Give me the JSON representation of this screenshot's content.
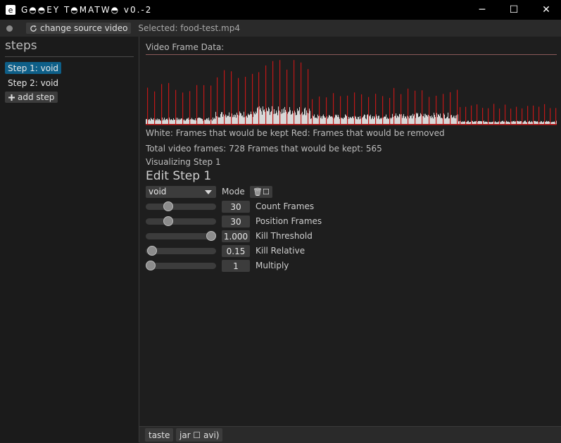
{
  "window": {
    "app_icon_glyph": "e",
    "title": "G◓◓EY T◓MATW◓ v0.-2",
    "controls": {
      "minimize": "─",
      "maximize": "☐",
      "close": "✕"
    }
  },
  "toolbar": {
    "change_source_label": "change source video",
    "change_source_icon": "refresh-icon",
    "selected_text": "Selected: food-test.mp4"
  },
  "steps_panel": {
    "title": "steps",
    "items": [
      {
        "label": "Step 1: void",
        "active": true
      },
      {
        "label": "Step 2: void",
        "active": false
      }
    ],
    "add_step_label": "add step",
    "add_step_icon": "plus-icon"
  },
  "main": {
    "chart_title": "Video Frame Data:",
    "legend_text": "White: Frames that would be kept   Red: Frames that would be removed",
    "stats_text": "Total video frames: 728   Frames that would be kept: 565",
    "visualizing_text": "Visualizing Step 1",
    "edit_title": "Edit Step 1",
    "mode_select_value": "void",
    "mode_label": "Mode",
    "mode_button_label": "🗑☐",
    "sliders": [
      {
        "value": 30,
        "display": "30",
        "label": "Count Frames",
        "fraction": 0.32
      },
      {
        "value": 30,
        "display": "30",
        "label": "Position Frames",
        "fraction": 0.32
      },
      {
        "value": 1.0,
        "display": "1.000",
        "label": "Kill Threshold",
        "fraction": 0.93
      },
      {
        "value": 0.15,
        "display": "0.15",
        "label": "Kill Relative",
        "fraction": 0.09
      },
      {
        "value": 1,
        "display": "1",
        "label": "Multiply",
        "fraction": 0.07
      }
    ]
  },
  "bottom_bar": {
    "taste_label": "taste",
    "jar_label": "jar ☐ avi)"
  },
  "colors": {
    "accent": "#0e5f88",
    "kept_frames": "#d8d8d8",
    "removed_frames": "#c01818"
  },
  "chart_data": {
    "type": "bar",
    "total_frames": 728,
    "kept_frames": 565,
    "series": [
      {
        "name": "White: Frames that would be kept",
        "color": "#d8d8d8"
      },
      {
        "name": "Red: Frames that would be removed",
        "color": "#c01818"
      }
    ],
    "segments": [
      {
        "x0": 0,
        "x1": 0.17,
        "kept_level": 0.08,
        "spike_level": 0.52
      },
      {
        "x0": 0.17,
        "x1": 0.27,
        "kept_level": 0.16,
        "spike_level": 0.67
      },
      {
        "x0": 0.27,
        "x1": 0.4,
        "kept_level": 0.22,
        "spike_level": 0.8
      },
      {
        "x0": 0.4,
        "x1": 0.6,
        "kept_level": 0.12,
        "spike_level": 0.4
      },
      {
        "x0": 0.6,
        "x1": 0.76,
        "kept_level": 0.14,
        "spike_level": 0.45
      },
      {
        "x0": 0.76,
        "x1": 1.0,
        "kept_level": 0.04,
        "spike_level": 0.25
      }
    ]
  }
}
